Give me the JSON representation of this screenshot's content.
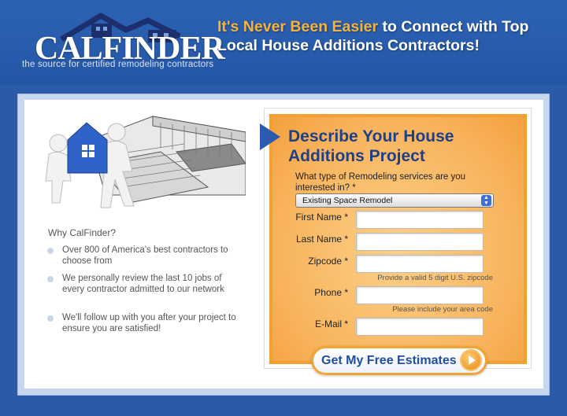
{
  "brand": {
    "logo_text": "CALFINDER",
    "tagline": "the source for certified remodeling contractors",
    "primary_color": "#2456a6",
    "accent_color": "#f4b33d",
    "logo_icon": "house-roof-icon"
  },
  "header": {
    "headline_highlight": "It's Never Been Easier",
    "headline_rest": " to Connect with Top Local House Additions Contractors!"
  },
  "left": {
    "hero_image": "movers-carrying-house-illustration",
    "why_title": "Why CalFinder?",
    "bullets": [
      {
        "text": "Over 800 of America's best contractors to choose from"
      },
      {
        "text": "We personally review the last 10 jobs of every contractor admitted to our network"
      },
      {
        "text": "We'll follow up with you after your project to ensure you are satisfied!"
      }
    ]
  },
  "form": {
    "title": "Describe Your House Additions Project",
    "question": "What type of Remodeling services are you interested in? *",
    "service_selected": "Existing Space Remodel",
    "fields": {
      "first_name": {
        "label": "First Name *",
        "value": ""
      },
      "last_name": {
        "label": "Last Name *",
        "value": ""
      },
      "zipcode": {
        "label": "Zipcode *",
        "value": "",
        "hint": "Provide a valid 5 digit U.S. zipcode"
      },
      "phone": {
        "label": "Phone *",
        "value": "",
        "hint": "Please include your area code"
      },
      "email": {
        "label": "E-Mail *",
        "value": ""
      }
    },
    "submit_label": "Get My Free Estimates",
    "form_color": "#f8b25a"
  }
}
